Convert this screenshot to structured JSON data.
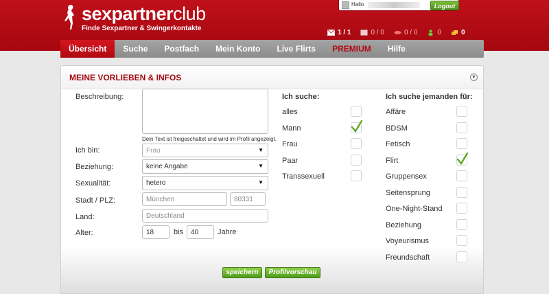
{
  "header": {
    "logo_bold": "sexpartner",
    "logo_light": "club",
    "tagline": "Finde Sexpartner & Swingerkontakte",
    "hallo": "Hallo",
    "logout_label": "Logout",
    "stats": [
      {
        "icon": "mail-icon",
        "text": "1 / 1"
      },
      {
        "icon": "message-icon",
        "text": "0 / 0"
      },
      {
        "icon": "kiss-icon",
        "text": "0 / 0"
      },
      {
        "icon": "person-icon",
        "text": "0"
      },
      {
        "icon": "coins-icon",
        "text": "0"
      }
    ]
  },
  "nav": {
    "items": [
      "Übersicht",
      "Suche",
      "Postfach",
      "Mein Konto",
      "Live Flirts",
      "PREMIUM",
      "Hilfe"
    ]
  },
  "panel": {
    "title": "MEINE VORLIEBEN & INFOS",
    "labels": {
      "beschreibung": "Beschreibung:",
      "ich_bin": "Ich bin:",
      "beziehung": "Beziehung:",
      "sexualitaet": "Sexualität:",
      "stadt": "Stadt / PLZ:",
      "land": "Land:",
      "alter": "Alter:",
      "bis": "bis",
      "jahre": "Jahre"
    },
    "note": "Dein Text ist freigeschaltet und wird im Profil angezeigt.",
    "values": {
      "ich_bin": "Frau",
      "beziehung": "keine Angabe",
      "sexualitaet": "hetero",
      "stadt": "München",
      "plz": "80331",
      "land": "Deutschland",
      "alter_von": "18",
      "alter_bis": "40"
    },
    "ich_suche": {
      "heading": "Ich suche:",
      "options": [
        {
          "label": "alles",
          "checked": false
        },
        {
          "label": "Mann",
          "checked": true
        },
        {
          "label": "Frau",
          "checked": false
        },
        {
          "label": "Paar",
          "checked": false
        },
        {
          "label": "Transsexuell",
          "checked": false
        }
      ]
    },
    "ich_suche_fuer": {
      "heading": "Ich suche jemanden für:",
      "options": [
        {
          "label": "Affäre",
          "checked": false
        },
        {
          "label": "BDSM",
          "checked": false
        },
        {
          "label": "Fetisch",
          "checked": false
        },
        {
          "label": "Flirt",
          "checked": true
        },
        {
          "label": "Gruppensex",
          "checked": false
        },
        {
          "label": "Seitensprung",
          "checked": false
        },
        {
          "label": "One-Night-Stand",
          "checked": false
        },
        {
          "label": "Beziehung",
          "checked": false
        },
        {
          "label": "Voyeurismus",
          "checked": false
        },
        {
          "label": "Freundschaft",
          "checked": false
        }
      ]
    },
    "buttons": {
      "save": "speichern",
      "preview": "Profilvorschau"
    }
  },
  "colors": {
    "brand_red": "#b30a12",
    "button_green": "#5fa826",
    "nav_grey": "#999999"
  }
}
